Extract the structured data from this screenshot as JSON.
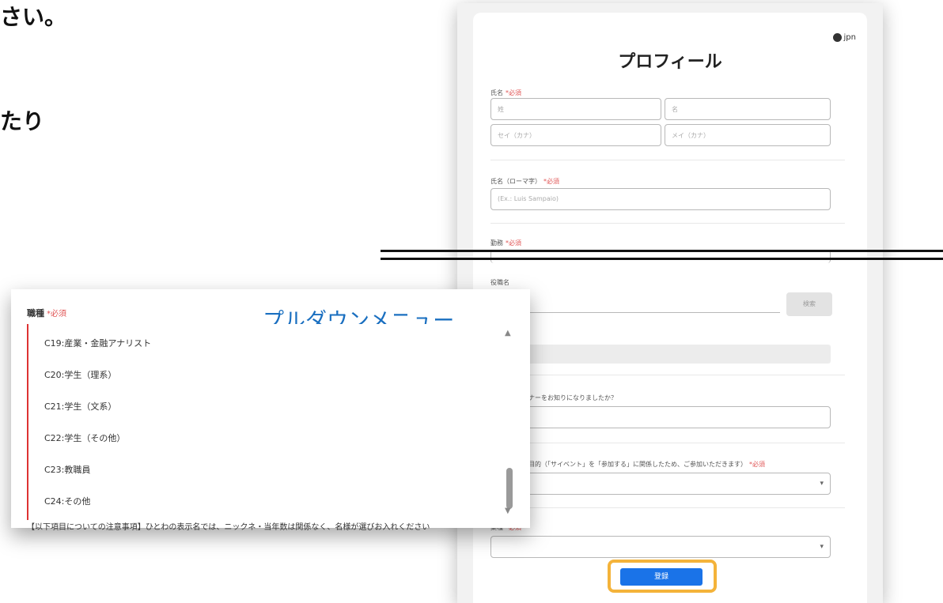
{
  "heading_fragment_1": "さい。",
  "heading_fragment_2": "たり",
  "form": {
    "lang": "jpn",
    "title": "プロフィール",
    "name_label": "氏名",
    "required": "*必須",
    "last_name_placeholder": "姓",
    "first_name_placeholder": "名",
    "last_kana_placeholder": "セイ（カナ）",
    "first_kana_placeholder": "メイ（カナ）",
    "roman_label": "氏名（ローマ字）",
    "roman_placeholder": "(Ex.: Luis Sampaio)",
    "company_label": "勤務",
    "section2_label": "役職名",
    "section2_button": "検索",
    "question_label": "当社開催セミナーをお知りになりましたか？",
    "purpose_label": "本日ご参加の目的（「サイベント」を「参加する」に関係したため、ご参加いただきます）",
    "select_label": "業種",
    "select_caret": "▾",
    "register_button": "登録"
  },
  "dropdown": {
    "label": "職種",
    "required": "*必須",
    "caption": "プルダウンメニュー",
    "options": [
      "C19:産業・金融アナリスト",
      "C20:学生（理系）",
      "C21:学生（文系）",
      "C22:学生（その他）",
      "C23:教職員",
      "C24:その他"
    ],
    "scroll_up": "▲",
    "scroll_down": "▼",
    "footer_text": "【以下項目についての注意事項】ひとわの表示名では、ニックネ・当年数は関係なく、名様が選びお入れください"
  }
}
